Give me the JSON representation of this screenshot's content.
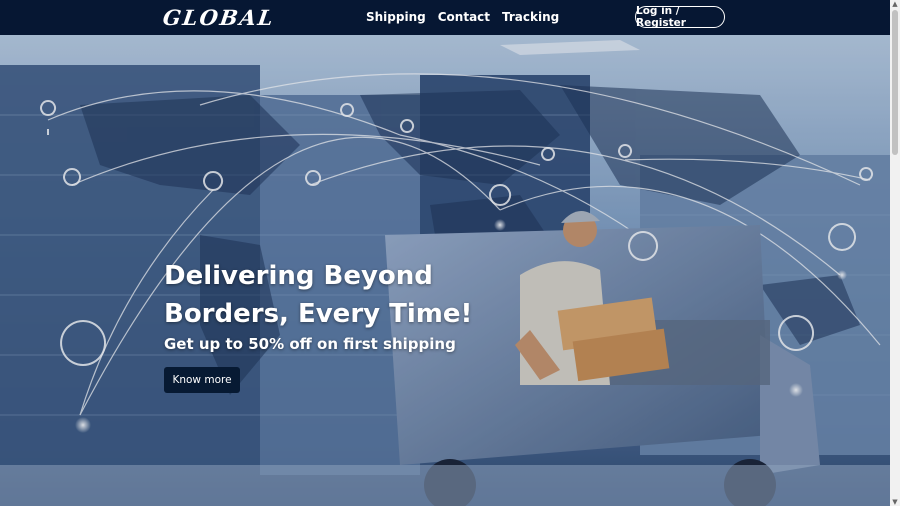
{
  "brand": {
    "logo_text": "GLOBAL"
  },
  "nav": {
    "links": [
      {
        "label": "Shipping"
      },
      {
        "label": "Contact"
      },
      {
        "label": "Tracking"
      }
    ],
    "login_label": "Log in / Register"
  },
  "hero": {
    "title": "Delivering Beyond Borders, Every Time!",
    "subtitle": "Get up to 50% off on first shipping",
    "cta_label": "Know more"
  },
  "colors": {
    "navbar_bg": "#061733",
    "cta_bg": "#071a33",
    "accent": "#ffffff"
  },
  "icons": [
    "map-pin-icon",
    "scroll-up-arrow-icon",
    "scroll-down-arrow-icon"
  ]
}
